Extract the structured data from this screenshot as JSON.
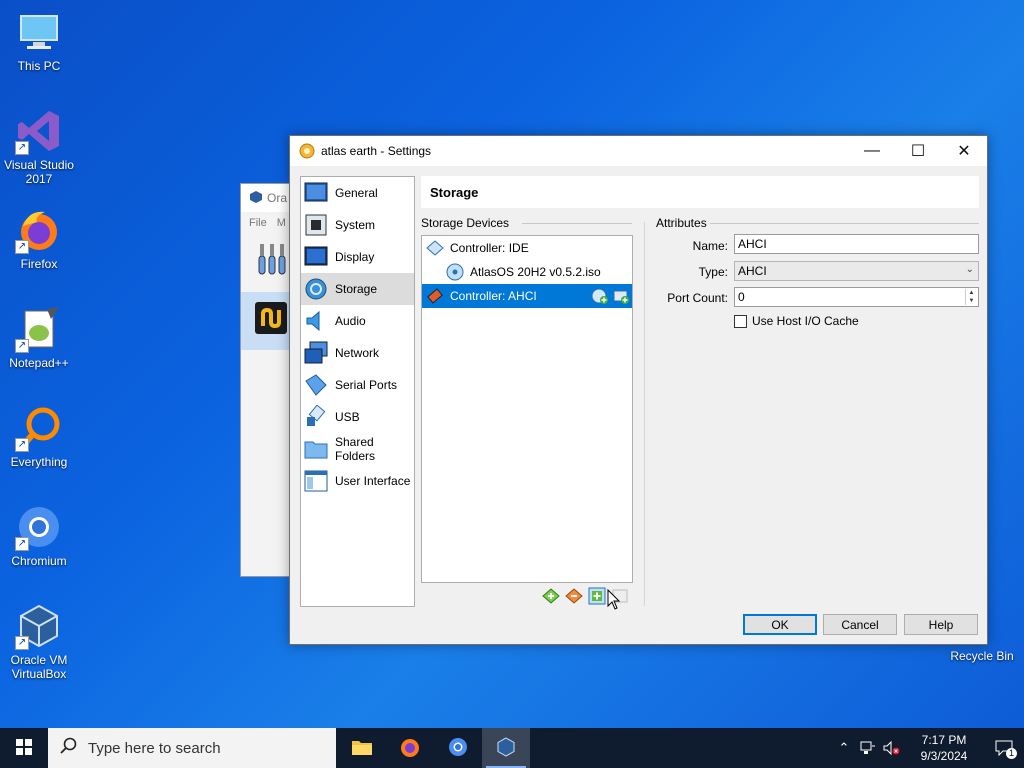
{
  "desktop": {
    "icons": [
      {
        "label": "This PC"
      },
      {
        "label": "Visual Studio 2017"
      },
      {
        "label": "Firefox"
      },
      {
        "label": "Notepad++"
      },
      {
        "label": "Everything"
      },
      {
        "label": "Chromium"
      },
      {
        "label": "Oracle VM VirtualBox"
      }
    ],
    "recycle_bin": "Recycle Bin"
  },
  "background_window": {
    "title": "Ora",
    "menu": [
      "File",
      "M"
    ]
  },
  "dialog": {
    "title": "atlas earth - Settings",
    "nav": [
      {
        "label": "General",
        "icon": "general-icon"
      },
      {
        "label": "System",
        "icon": "system-icon"
      },
      {
        "label": "Display",
        "icon": "display-icon"
      },
      {
        "label": "Storage",
        "icon": "storage-icon",
        "active": true
      },
      {
        "label": "Audio",
        "icon": "audio-icon"
      },
      {
        "label": "Network",
        "icon": "network-icon"
      },
      {
        "label": "Serial Ports",
        "icon": "serial-ports-icon"
      },
      {
        "label": "USB",
        "icon": "usb-icon"
      },
      {
        "label": "Shared Folders",
        "icon": "shared-folders-icon"
      },
      {
        "label": "User Interface",
        "icon": "user-interface-icon"
      }
    ],
    "page_title": "Storage",
    "storage_devices_label": "Storage Devices",
    "tree": [
      {
        "label": "Controller: IDE"
      },
      {
        "label": "AtlasOS 20H2 v0.5.2.iso"
      },
      {
        "label": "Controller: AHCI"
      }
    ],
    "attributes": {
      "group_label": "Attributes",
      "name_label": "Name:",
      "name_value": "AHCI",
      "type_label": "Type:",
      "type_value": "AHCI",
      "port_count_label": "Port Count:",
      "port_count_value": "0",
      "host_io_cache_label": "Use Host I/O Cache",
      "host_io_cache_checked": false
    },
    "buttons": {
      "ok": "OK",
      "cancel": "Cancel",
      "help": "Help"
    }
  },
  "taskbar": {
    "search_placeholder": "Type here to search",
    "time": "7:17 PM",
    "date": "9/3/2024",
    "notification_count": "1"
  },
  "colors": {
    "desktop": "#0b63e0",
    "selection": "#0078d7",
    "taskbar": "#0f1b2e"
  }
}
